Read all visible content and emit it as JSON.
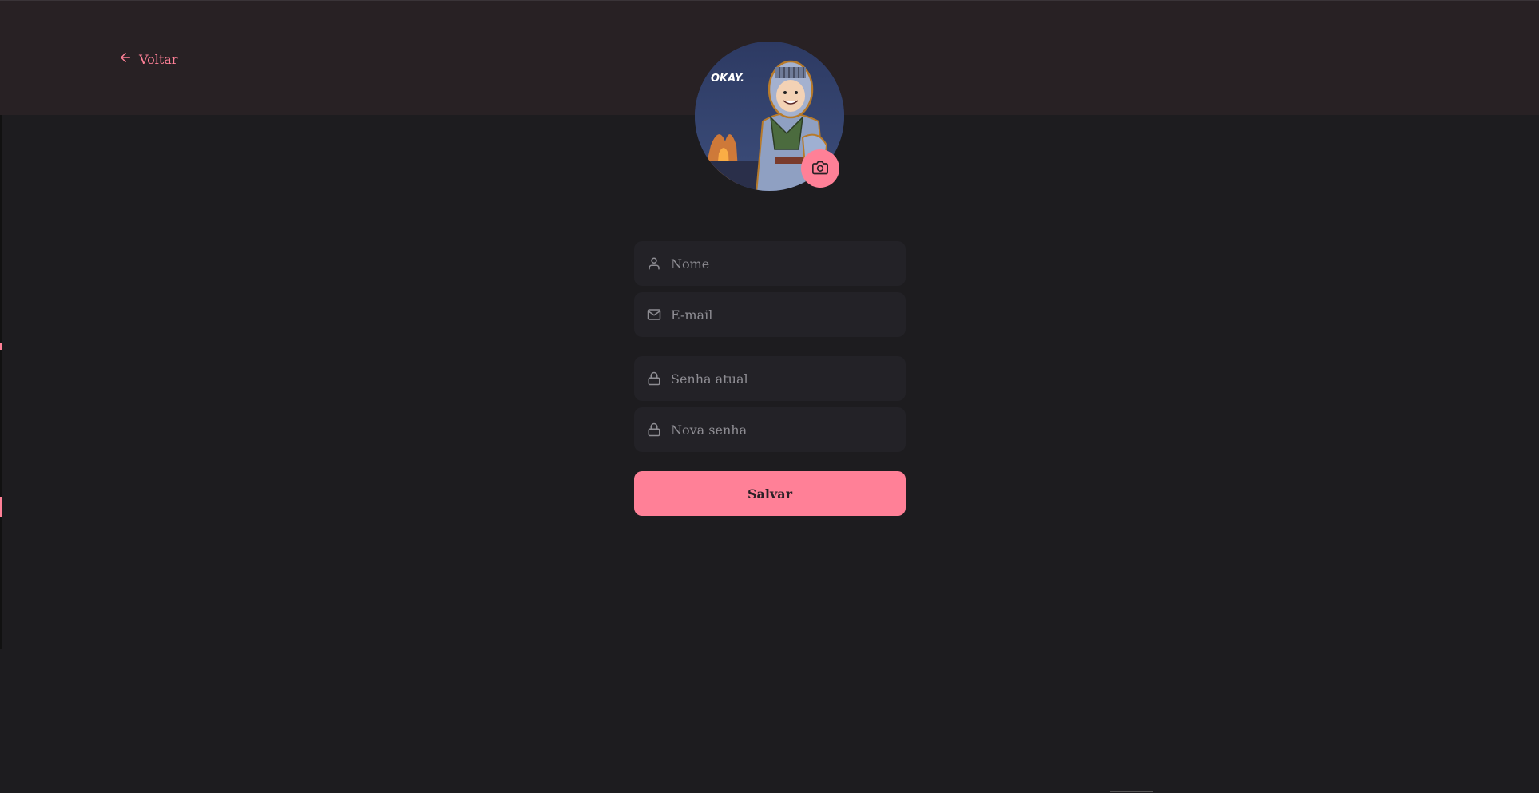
{
  "header": {
    "back_label": "Voltar"
  },
  "avatar": {
    "speech_text": "OKAY."
  },
  "form": {
    "name_placeholder": "Nome",
    "email_placeholder": "E-mail",
    "current_password_placeholder": "Senha atual",
    "new_password_placeholder": "Nova senha",
    "save_label": "Salvar"
  },
  "colors": {
    "accent": "#ff8097",
    "background": "#1d1c1f",
    "header": "#282124",
    "input": "#232227"
  },
  "icons": [
    "arrow-left-icon",
    "camera-icon",
    "user-icon",
    "mail-icon",
    "lock-icon"
  ]
}
